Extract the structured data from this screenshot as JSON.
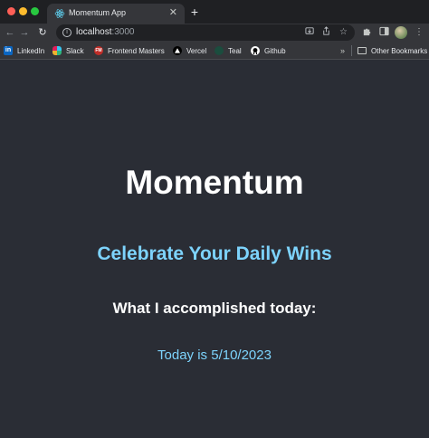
{
  "browser": {
    "tab": {
      "title": "Momentum App",
      "close": "✕",
      "favicon": "react-icon"
    },
    "new_tab": "+",
    "address_bar": {
      "host": "localhost",
      "port": ":3000"
    },
    "nav": {
      "back": "←",
      "forward": "→",
      "reload": "↻"
    }
  },
  "bookmarks": {
    "items": [
      {
        "label": "LinkedIn",
        "icon": "linkedin-icon",
        "color": "#0a66c2"
      },
      {
        "label": "Slack",
        "icon": "slack-icon",
        "color": "#e01e5a"
      },
      {
        "label": "Frontend Masters",
        "icon": "frontend-masters-icon",
        "color": "#c02d28"
      },
      {
        "label": "Vercel",
        "icon": "vercel-icon",
        "color": "#ffffff"
      },
      {
        "label": "Teal",
        "icon": "teal-icon",
        "color": "#1b4d3e"
      },
      {
        "label": "Github",
        "icon": "github-icon",
        "color": "#ffffff"
      }
    ],
    "overflow": "»",
    "other": "Other Bookmarks"
  },
  "page": {
    "title": "Momentum",
    "subtitle": "Celebrate Your Daily Wins",
    "accomplished_heading": "What I accomplished today:",
    "today_text": "Today is 5/10/2023",
    "accent_color": "#7dd3fc",
    "background_color": "#2a2d35"
  }
}
